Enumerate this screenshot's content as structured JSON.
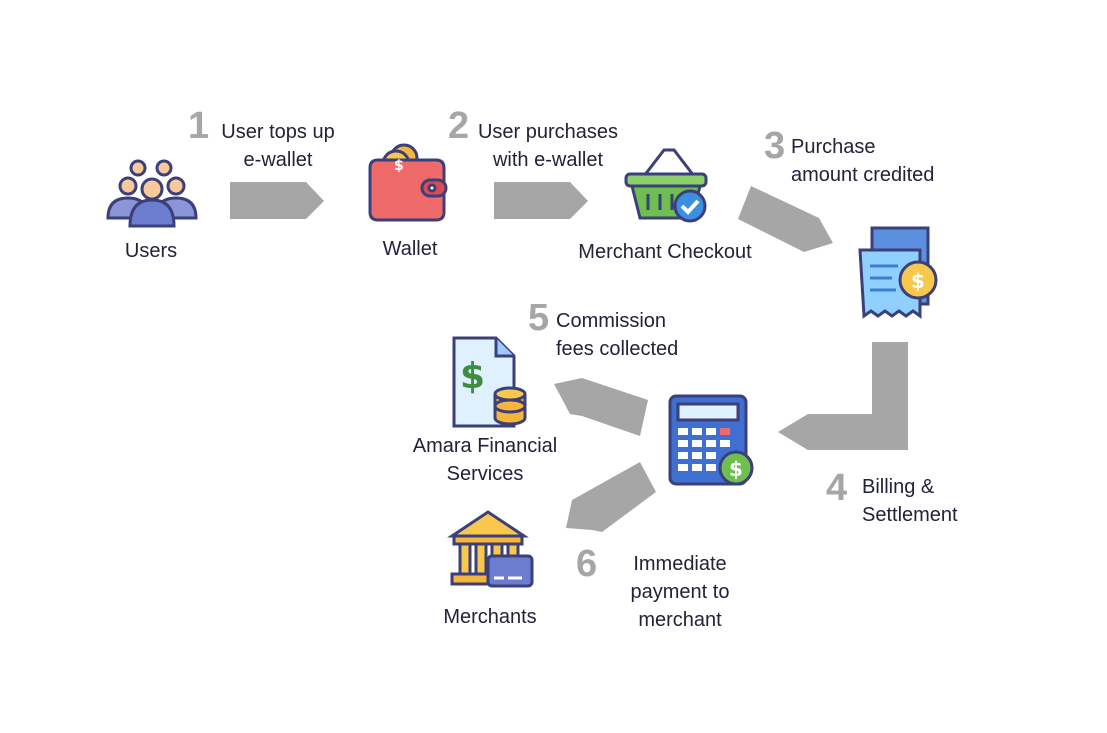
{
  "nodes": {
    "users": "Users",
    "wallet": "Wallet",
    "merchant_checkout": "Merchant Checkout",
    "amara_line1": "Amara Financial",
    "amara_line2": "Services",
    "merchants": "Merchants"
  },
  "steps": [
    {
      "number": "1",
      "line1": "User tops up",
      "line2": "e-wallet"
    },
    {
      "number": "2",
      "line1": "User purchases",
      "line2": "with e-wallet"
    },
    {
      "number": "3",
      "line1": "Purchase",
      "line2": "amount credited"
    },
    {
      "number": "4",
      "line1": "Billing &",
      "line2": "Settlement"
    },
    {
      "number": "5",
      "line1": "Commission",
      "line2": "fees collected"
    },
    {
      "number": "6",
      "line1": "Immediate",
      "line2": "payment to",
      "line3": "merchant"
    }
  ],
  "colors": {
    "arrow": "#a6a6a6",
    "step_number": "#a6a6a6",
    "icon_outline": "#3b3f7a"
  }
}
